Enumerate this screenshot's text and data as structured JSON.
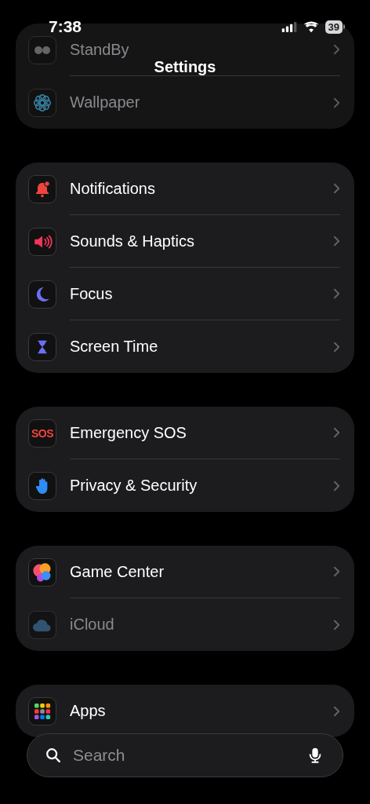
{
  "status_bar": {
    "time": "7:38",
    "battery": "39"
  },
  "title": "Settings",
  "groups": [
    {
      "rows": [
        {
          "label": "StandBy",
          "kind": "standby",
          "dimmed": true
        },
        {
          "label": "Wallpaper",
          "kind": "wallpaper",
          "dimmed": true
        }
      ]
    },
    {
      "rows": [
        {
          "label": "Notifications",
          "kind": "bell",
          "dimmed": false
        },
        {
          "label": "Sounds & Haptics",
          "kind": "speaker",
          "dimmed": false
        },
        {
          "label": "Focus",
          "kind": "moon",
          "dimmed": false
        },
        {
          "label": "Screen Time",
          "kind": "hourglass",
          "dimmed": false
        }
      ]
    },
    {
      "rows": [
        {
          "label": "Emergency SOS",
          "kind": "sos",
          "icon_text": "SOS",
          "dimmed": false
        },
        {
          "label": "Privacy & Security",
          "kind": "hand",
          "dimmed": false
        }
      ]
    },
    {
      "rows": [
        {
          "label": "Game Center",
          "kind": "bubbles",
          "dimmed": false
        },
        {
          "label": "iCloud",
          "kind": "cloud",
          "dimmed": true
        }
      ]
    },
    {
      "rows": [
        {
          "label": "Apps",
          "kind": "grid",
          "dimmed": false
        }
      ]
    }
  ],
  "search": {
    "placeholder": "Search"
  }
}
